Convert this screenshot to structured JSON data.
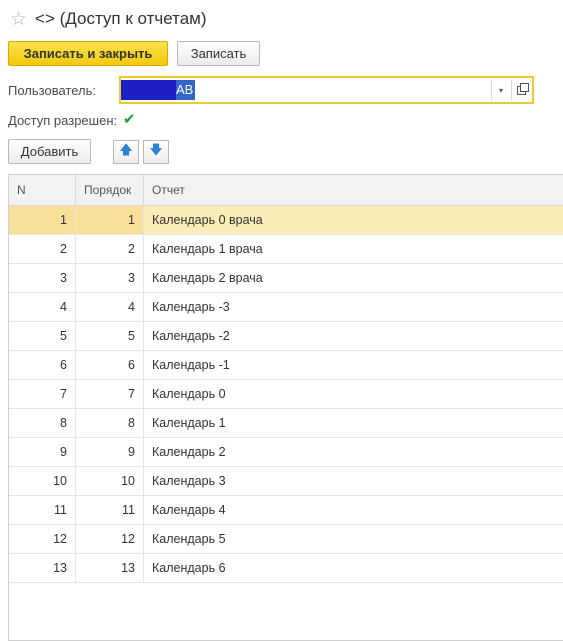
{
  "window": {
    "title": "<> (Доступ к отчетам)"
  },
  "toolbar": {
    "save_close_label": "Записать и закрыть",
    "save_label": "Записать"
  },
  "form": {
    "user_label": "Пользователь:",
    "user_value": "AB",
    "access_label": "Доступ разрешен:",
    "access_checked": true
  },
  "actions": {
    "add_label": "Добавить",
    "move_up_icon": "arrow-up-icon",
    "move_down_icon": "arrow-down-icon"
  },
  "table": {
    "columns": [
      "N",
      "Порядок",
      "Отчет"
    ],
    "rows": [
      {
        "n": "1",
        "order": "1",
        "report": "Календарь 0 врача"
      },
      {
        "n": "2",
        "order": "2",
        "report": "Календарь 1 врача"
      },
      {
        "n": "3",
        "order": "3",
        "report": "Календарь 2 врача"
      },
      {
        "n": "4",
        "order": "4",
        "report": "Календарь -3"
      },
      {
        "n": "5",
        "order": "5",
        "report": "Календарь -2"
      },
      {
        "n": "6",
        "order": "6",
        "report": "Календарь -1"
      },
      {
        "n": "7",
        "order": "7",
        "report": "Календарь 0"
      },
      {
        "n": "8",
        "order": "8",
        "report": "Календарь 1"
      },
      {
        "n": "9",
        "order": "9",
        "report": "Календарь 2"
      },
      {
        "n": "10",
        "order": "10",
        "report": "Календарь 3"
      },
      {
        "n": "11",
        "order": "11",
        "report": "Календарь 4"
      },
      {
        "n": "12",
        "order": "12",
        "report": "Календарь 5"
      },
      {
        "n": "13",
        "order": "13",
        "report": "Календарь 6"
      }
    ],
    "selected_row": 0
  },
  "colors": {
    "primary_button": "#f2c80f",
    "focus_border": "#f0c92d",
    "selected_row": "#fcecb8",
    "check": "#18a23c",
    "arrow": "#2d7fd8"
  }
}
